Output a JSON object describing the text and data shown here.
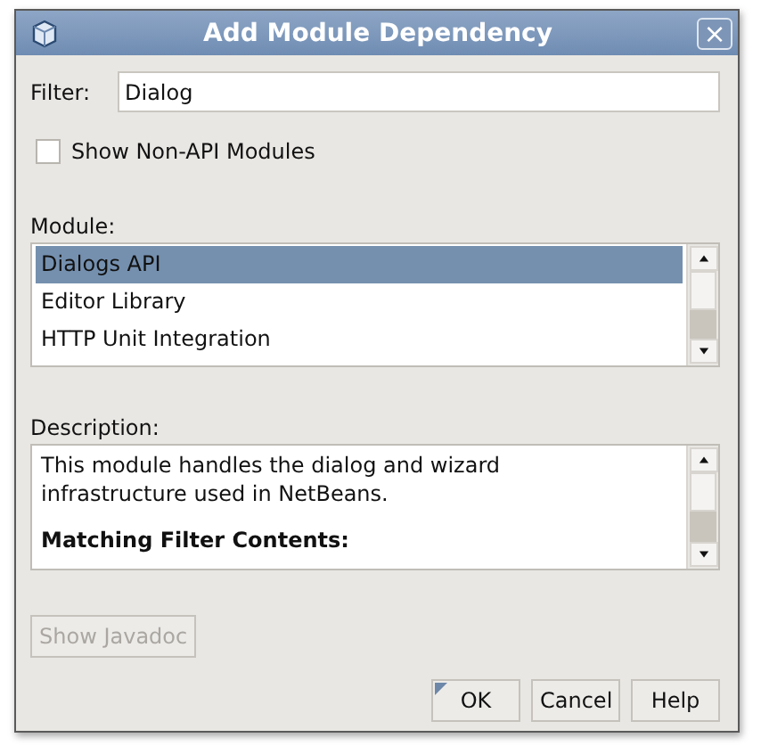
{
  "window": {
    "title": "Add Module Dependency",
    "close": "×"
  },
  "filter": {
    "label": "Filter:",
    "value": "Dialog"
  },
  "show_non_api": {
    "label": "Show Non-API Modules",
    "checked": false
  },
  "module_list": {
    "label": "Module:",
    "items": [
      {
        "name": "Dialogs API",
        "selected": true
      },
      {
        "name": "Editor Library",
        "selected": false
      },
      {
        "name": "HTTP Unit Integration",
        "selected": false
      }
    ]
  },
  "description": {
    "label": "Description:",
    "text": "This module handles the dialog and wizard infrastructure used in NetBeans.",
    "heading": "Matching Filter Contents:"
  },
  "javadoc_button": {
    "label": "Show Javadoc",
    "disabled": true
  },
  "buttons": [
    {
      "label": "OK",
      "default": true
    },
    {
      "label": "Cancel",
      "default": false
    },
    {
      "label": "Help",
      "default": false
    }
  ]
}
